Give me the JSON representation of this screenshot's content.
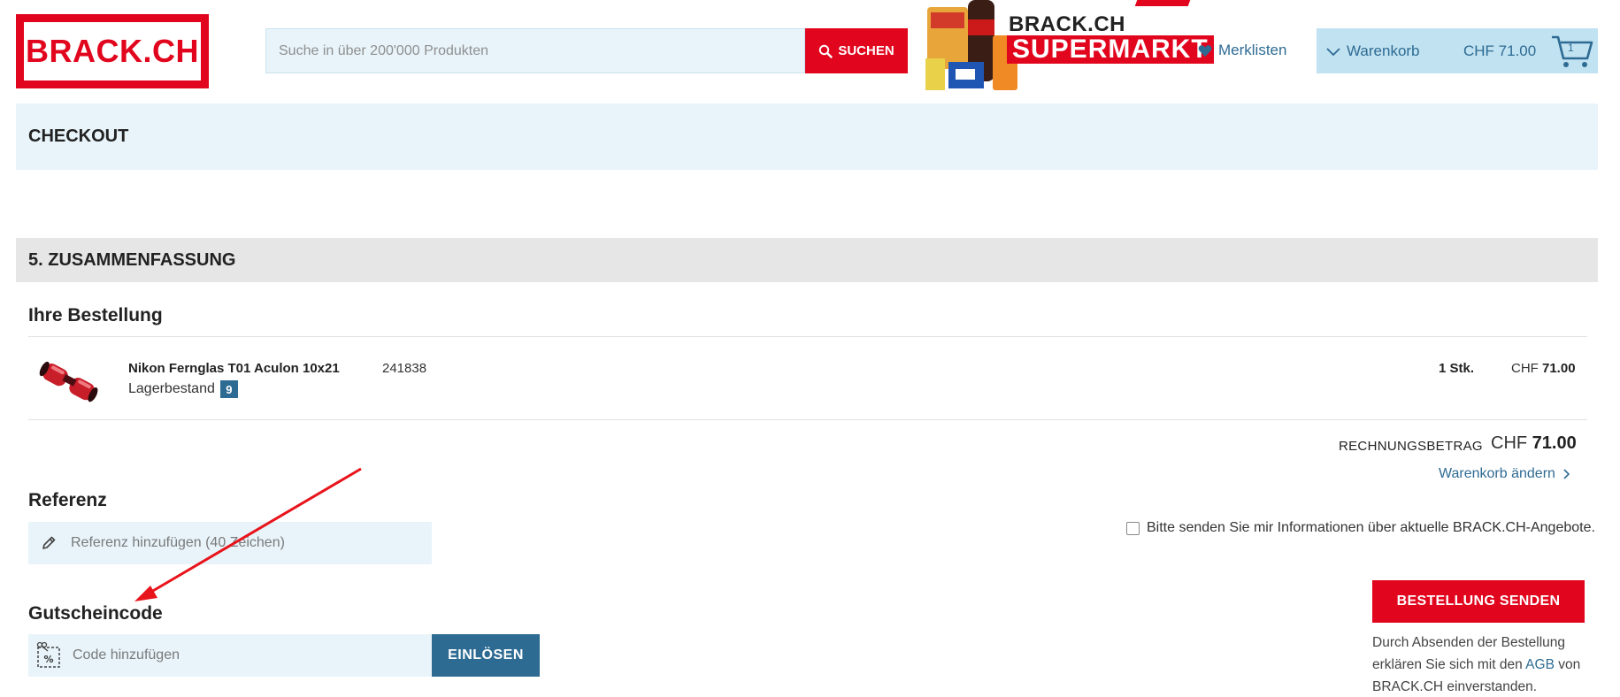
{
  "header": {
    "logo_text": "BRACK.CH",
    "search_placeholder": "Suche in über 200'000 Produkten",
    "search_button": "SUCHEN",
    "promo_brand": "BRACK.CH",
    "promo_title": "SUPERMARKT",
    "wishlist_label": "Merklisten",
    "cart_label": "Warenkorb",
    "cart_total": "CHF 71.00",
    "cart_count": "1"
  },
  "checkout": {
    "title": "CHECKOUT",
    "step_title": "5. ZUSAMMENFASSUNG",
    "order_heading": "Ihre Bestellung"
  },
  "order": {
    "item": {
      "name": "Nikon Fernglas T01 Aculon 10x21",
      "stock_label": "Lagerbestand",
      "stock_count": "9",
      "article_number": "241838",
      "quantity": "1 Stk.",
      "currency": "CHF",
      "price": "71.00"
    },
    "total_label": "RECHNUNGSBETRAG",
    "total_currency": "CHF",
    "total_amount": "71.00",
    "edit_cart_link": "Warenkorb ändern"
  },
  "reference": {
    "heading": "Referenz",
    "placeholder": "Referenz hinzufügen (40 Zeichen)"
  },
  "voucher": {
    "heading": "Gutscheincode",
    "placeholder": "Code hinzufügen",
    "redeem_button": "EINLÖSEN"
  },
  "newsletter": {
    "label": "Bitte senden Sie mir Informationen über aktuelle BRACK.CH-Angebote.",
    "checked": false
  },
  "submit": {
    "button": "BESTELLUNG SENDEN",
    "legal_before": "Durch Absenden der Bestellung erklären Sie sich mit den",
    "legal_link": "AGB",
    "legal_after": "von BRACK.CH einverstanden."
  },
  "colors": {
    "brand_red": "#e1051d",
    "link_blue": "#2e6b93",
    "light_blue": "#e8f4fa",
    "annotation_arrow": "#e8141c"
  },
  "icons": [
    "search-icon",
    "heart-icon",
    "chevron-down-icon",
    "cart-icon",
    "chevron-right-icon",
    "pencil-icon",
    "voucher-icon"
  ]
}
